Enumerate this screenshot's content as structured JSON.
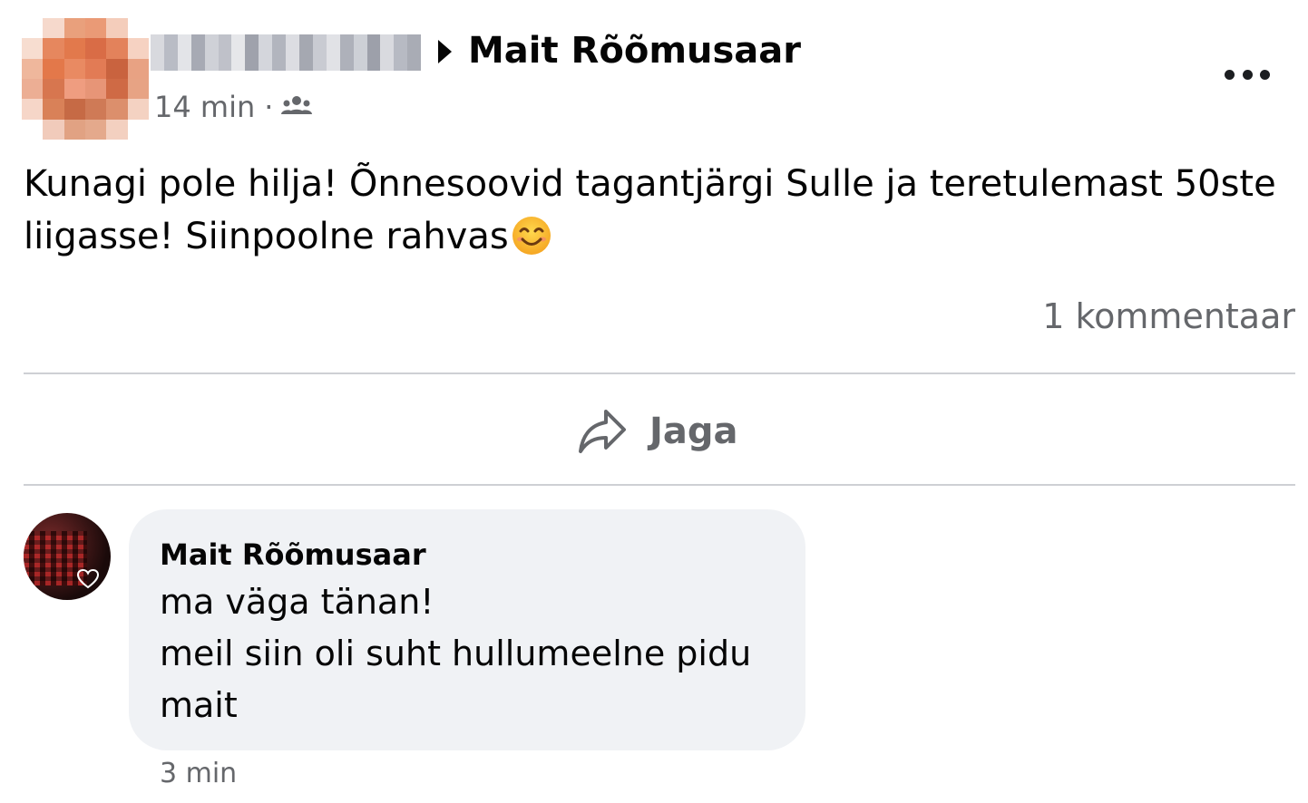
{
  "post": {
    "target_name": "Mait Rõõmusaar",
    "timestamp": "14 min",
    "separator": "·",
    "audience_icon": "friends-icon",
    "more_icon": "ellipsis-icon",
    "text_line1": "Kunagi pole hilja! Õnnesoovid tagantjärgi Sulle ja teretulemast 50ste",
    "text_line2": "liigasse! Siinpoolne rahvas",
    "emoji": "smiling-face-emoji",
    "comment_count": "1 kommentaar"
  },
  "actions": {
    "share_label": "Jaga",
    "share_icon": "share-arrow-icon"
  },
  "comment": {
    "author": "Mait Rõõmusaar",
    "line1": "ma väga tänan!",
    "line2": "meil siin oli suht hullumeelne pidu",
    "line3": "mait",
    "time": "3 min"
  },
  "colors": {
    "text_primary": "#050505",
    "text_secondary": "#65676b",
    "bubble_bg": "#f0f2f5",
    "divider": "#ced0d4"
  }
}
